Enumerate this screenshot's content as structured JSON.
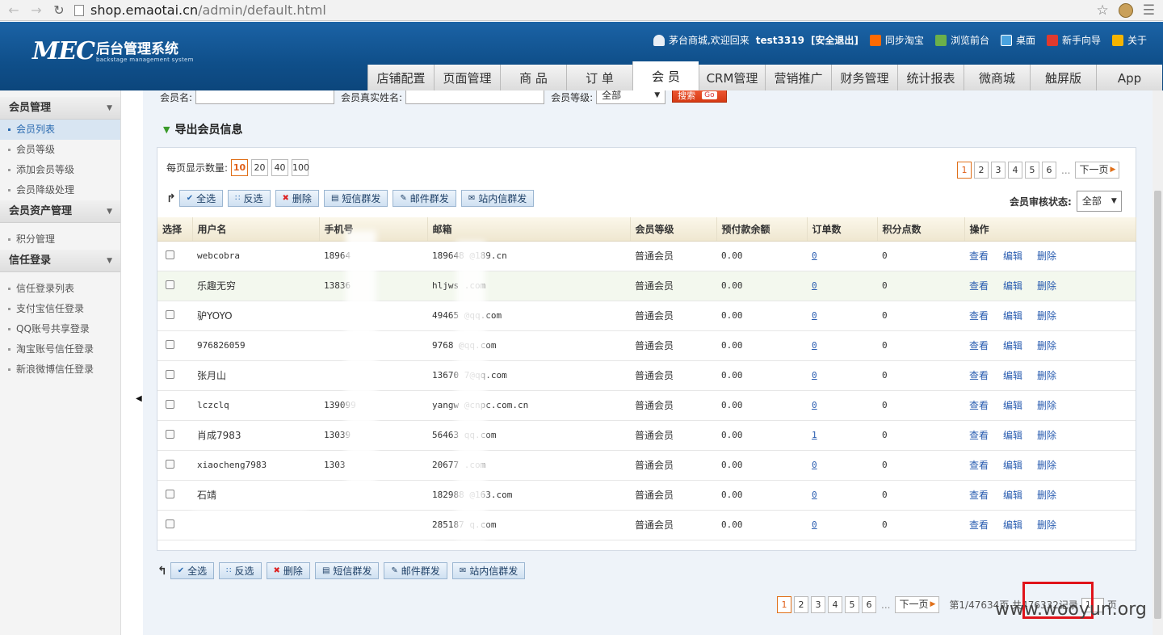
{
  "browser": {
    "url_host": "shop.emaotai.cn",
    "url_path": "/admin/default.html"
  },
  "header": {
    "logo_main": "MEC",
    "logo_cn": "后台管理系统",
    "logo_en": "backstage management system",
    "welcome": "茅台商城,欢迎回来",
    "username": "test3319",
    "safe_exit": "[安全退出]",
    "links": {
      "sync_taobao": "同步淘宝",
      "browse_front": "浏览前台",
      "desktop": "桌面",
      "guide": "新手向导",
      "about": "关于"
    },
    "tabs": [
      "店铺配置",
      "页面管理",
      "商 品",
      "订 单",
      "会 员",
      "CRM管理",
      "营销推广",
      "财务管理",
      "统计报表",
      "微商城",
      "触屏版",
      "App"
    ]
  },
  "sidebar": {
    "groups": [
      {
        "title": "会员管理",
        "items": [
          "会员列表",
          "会员等级",
          "添加会员等级",
          "会员降级处理"
        ]
      },
      {
        "title": "会员资产管理",
        "items": [
          "积分管理"
        ]
      },
      {
        "title": "信任登录",
        "items": [
          "信任登录列表",
          "支付宝信任登录",
          "QQ账号共享登录",
          "淘宝账号信任登录",
          "新浪微博信任登录"
        ]
      }
    ]
  },
  "filters": {
    "member_name_label": "会员名:",
    "real_name_label": "会员真实姓名:",
    "grade_label": "会员等级:",
    "grade_value": "全部",
    "search_label": "搜索",
    "go_label": "Go"
  },
  "export_label": "导出会员信息",
  "page_size": {
    "label": "每页显示数量:",
    "options": [
      "10",
      "20",
      "40",
      "100"
    ]
  },
  "pager": {
    "pages": [
      "1",
      "2",
      "3",
      "4",
      "5",
      "6"
    ],
    "ellipsis": "...",
    "next": "下一页"
  },
  "actions": {
    "select_all": "全选",
    "invert": "反选",
    "delete": "删除",
    "sms": "短信群发",
    "mail": "邮件群发",
    "inbox": "站内信群发"
  },
  "audit": {
    "label": "会员审核状态:",
    "value": "全部"
  },
  "table": {
    "headers": [
      "选择",
      "用户名",
      "手机号",
      "邮箱",
      "会员等级",
      "预付款余额",
      "订单数",
      "积分点数",
      "操作"
    ],
    "ops": [
      "查看",
      "编辑",
      "删除"
    ],
    "rows": [
      {
        "user": "webcobra",
        "phone": "18964",
        "email": "189648      @189.cn",
        "grade": "普通会员",
        "balance": "0.00",
        "orders": "0",
        "points": "0"
      },
      {
        "user": "乐趣无穷",
        "phone": "13836",
        "email": "hljws      .com",
        "grade": "普通会员",
        "balance": "0.00",
        "orders": "0",
        "points": "0"
      },
      {
        "user": "驴YOYO",
        "phone": "",
        "email": "49465      @qq.com",
        "grade": "普通会员",
        "balance": "0.00",
        "orders": "0",
        "points": "0"
      },
      {
        "user": "976826059",
        "phone": "",
        "email": "9768      @qq.com",
        "grade": "普通会员",
        "balance": "0.00",
        "orders": "0",
        "points": "0"
      },
      {
        "user": "张月山",
        "phone": "",
        "email": "13670      7@qq.com",
        "grade": "普通会员",
        "balance": "0.00",
        "orders": "0",
        "points": "0"
      },
      {
        "user": "lczclq",
        "phone": "139099",
        "email": "yangw      @cnpc.com.cn",
        "grade": "普通会员",
        "balance": "0.00",
        "orders": "0",
        "points": "0"
      },
      {
        "user": "肖成7983",
        "phone": "13039",
        "email": "56463      qq.com",
        "grade": "普通会员",
        "balance": "0.00",
        "orders": "1",
        "points": "0"
      },
      {
        "user": "xiaocheng7983",
        "phone": "1303",
        "email": "20677      .com",
        "grade": "普通会员",
        "balance": "0.00",
        "orders": "0",
        "points": "0"
      },
      {
        "user": "石靖",
        "phone": "",
        "email": "182988      @163.com",
        "grade": "普通会员",
        "balance": "0.00",
        "orders": "0",
        "points": "0"
      },
      {
        "user": "",
        "phone": "",
        "email": "285187      q.com",
        "grade": "普通会员",
        "balance": "0.00",
        "orders": "0",
        "points": "0"
      }
    ]
  },
  "footer": {
    "page_info": "第1/47634页 共476332记录",
    "jump_value": "1",
    "page_unit": "页"
  },
  "watermark": "www.wooyun.org"
}
